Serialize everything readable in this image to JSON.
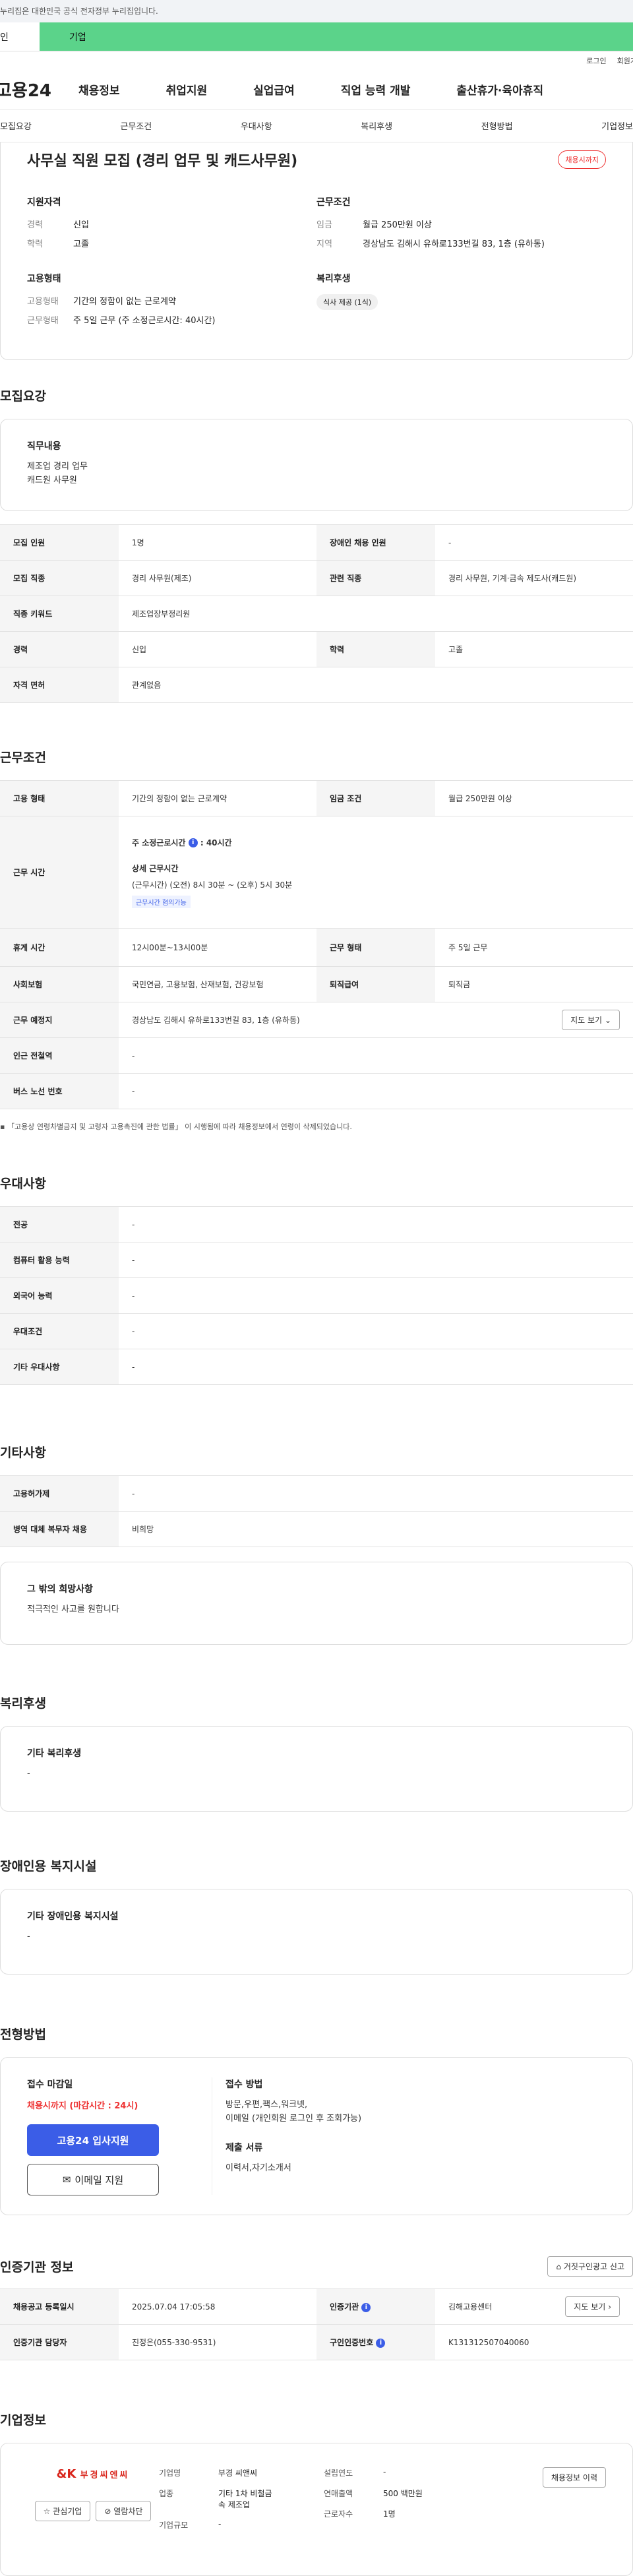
{
  "gov_notice": "누리집은 대한민국 공식 전자정부 누리집입니다.",
  "tabs": {
    "person": "인",
    "company": "기업"
  },
  "util": {
    "login": "로그인",
    "join": "회원가"
  },
  "logo": "고용24",
  "gnb": [
    "채용정보",
    "취업지원",
    "실업급여",
    "직업 능력 개발",
    "출산휴가·육아휴직"
  ],
  "subnav": [
    "모집요강",
    "근무조건",
    "우대사항",
    "복리후생",
    "전형방법",
    "기업정보"
  ],
  "summary": {
    "title": "사무실 직원 모집 (경리 업무 및 캐드사무원)",
    "badge": "채용시까지",
    "qual_h": "지원자격",
    "career_k": "경력",
    "career_v": "신입",
    "edu_k": "학력",
    "edu_v": "고졸",
    "cond_h": "근무조건",
    "wage_k": "임금",
    "wage_v": "월급 250만원 이상",
    "region_k": "지역",
    "region_v": "경상남도 김해시 유하로133번길 83, 1층 (유하동)",
    "emp_h": "고용형태",
    "emptype_k": "고용형태",
    "emptype_v": "기간의 정함이 없는 근로계약",
    "worktype_k": "근무형태",
    "worktype_v": "주 5일 근무 (주 소정근로시간: 40시간)",
    "welfare_h": "복리후생",
    "welfare_pill": "식사 제공 (1식)"
  },
  "recruit": {
    "title": "모집요강",
    "duty_h": "직무내용",
    "duty_l1": "제조업 경리 업무",
    "duty_l2": "캐드원 사무원",
    "rows": {
      "count_k": "모집 인원",
      "count_v": "1명",
      "disabled_k": "장애인 채용 인원",
      "disabled_v": "-",
      "job_k": "모집 직종",
      "job_v": "경리 사무원(제조)",
      "rel_k": "관련 직종",
      "rel_v": "경리 사무원, 기계·금속 제도사(캐드원)",
      "kw_k": "직종 키워드",
      "kw_v": "제조업장부정리원",
      "career_k": "경력",
      "career_v": "신입",
      "edu_k": "학력",
      "edu_v": "고졸",
      "license_k": "자격 면허",
      "license_v": "관계없음"
    }
  },
  "work": {
    "title": "근무조건",
    "emp_k": "고용 형태",
    "emp_v": "기간의 정함이 없는 근로계약",
    "wage_k": "임금 조건",
    "wage_v": "월급 250만원 이상",
    "hours_k": "근무 시간",
    "weekly_label": "주 소정근로시간",
    "weekly_value": ": 40시간",
    "detail_h": "상세 근무시간",
    "detail_v": "(근무시간) (오전) 8시 30분 ~ (오후) 5시 30분",
    "detail_tag": "근무시간 협의가능",
    "break_k": "휴게 시간",
    "break_v": "12시00분~13시00분",
    "wtype_k": "근무 형태",
    "wtype_v": "주 5일 근무",
    "ins_k": "사회보험",
    "ins_v": "국민연금, 고용보험, 산재보험, 건강보험",
    "sev_k": "퇴직급여",
    "sev_v": "퇴직금",
    "place_k": "근무 예정지",
    "place_v": "경상남도 김해시 유하로133번길 83, 1층 (유하동)",
    "map_btn": "지도 보기",
    "subway_k": "인근 전철역",
    "subway_v": "-",
    "bus_k": "버스 노선 번호",
    "bus_v": "-",
    "note": "「고용상 연령차별금지 및 고령자 고용촉진에 관한 법률」 이 시행됨에 따라 채용정보에서 연령이 삭제되었습니다."
  },
  "pref": {
    "title": "우대사항",
    "major_k": "전공",
    "major_v": "-",
    "pc_k": "컴퓨터 활용 능력",
    "pc_v": "-",
    "lang_k": "외국어 능력",
    "lang_v": "-",
    "cond_k": "우대조건",
    "cond_v": "-",
    "etc_k": "기타 우대사항",
    "etc_v": "-"
  },
  "etc": {
    "title": "기타사항",
    "permit_k": "고용허가제",
    "permit_v": "-",
    "mil_k": "병역 대체 복무자 채용",
    "mil_v": "비희망",
    "other_h": "그 밖의 희망사항",
    "other_v": "적극적인 사고를 원합니다"
  },
  "welfare": {
    "title": "복리후생",
    "box_h": "기타 복리후생",
    "box_v": "-"
  },
  "disab": {
    "title": "장애인용 복지시설",
    "box_h": "기타 장애인용 복지시설",
    "box_v": "-"
  },
  "select": {
    "title": "전형방법",
    "deadline_h": "접수 마감일",
    "deadline_v": "채용시까지 (마감시간 : 24시)",
    "apply_btn": "고용24 입사지원",
    "email_btn": "이메일 지원",
    "method_h": "접수 방법",
    "method_l1": "방문,우편,팩스,워크넷,",
    "method_l2": "이메일 (개인회원 로그인 후 조회가능)",
    "docs_h": "제출 서류",
    "docs_v": "이력서,자기소개서"
  },
  "cert": {
    "title": "인증기관 정보",
    "report_btn": "거짓구인광고 신고",
    "reg_k": "채용공고 등록일시",
    "reg_v": "2025.07.04 17:05:58",
    "org_k": "인증기관",
    "org_v": "김해고용센터",
    "map_btn": "지도 보기",
    "mgr_k": "인증기관 담당자",
    "mgr_v": "진정은(055-330-9531)",
    "num_k": "구인인증번호",
    "num_v": "K131312507040060"
  },
  "company": {
    "title": "기업정보",
    "logo_mark": "&K",
    "logo_text": "부경씨엔씨",
    "fav_btn": "관심기업",
    "block_btn": "열람차단",
    "name_k": "기업명",
    "name_v": "부경 씨앤씨",
    "ind_k": "업종",
    "ind_v1": "기타 1차 비철금",
    "ind_v2": "속 제조업",
    "size_k": "기업규모",
    "size_v": "-",
    "year_k": "설립연도",
    "year_v": "-",
    "sales_k": "연매출액",
    "sales_v": "500 백만원",
    "emp_k": "근로자수",
    "emp_v": "1명",
    "history_btn": "채용정보 이력"
  }
}
